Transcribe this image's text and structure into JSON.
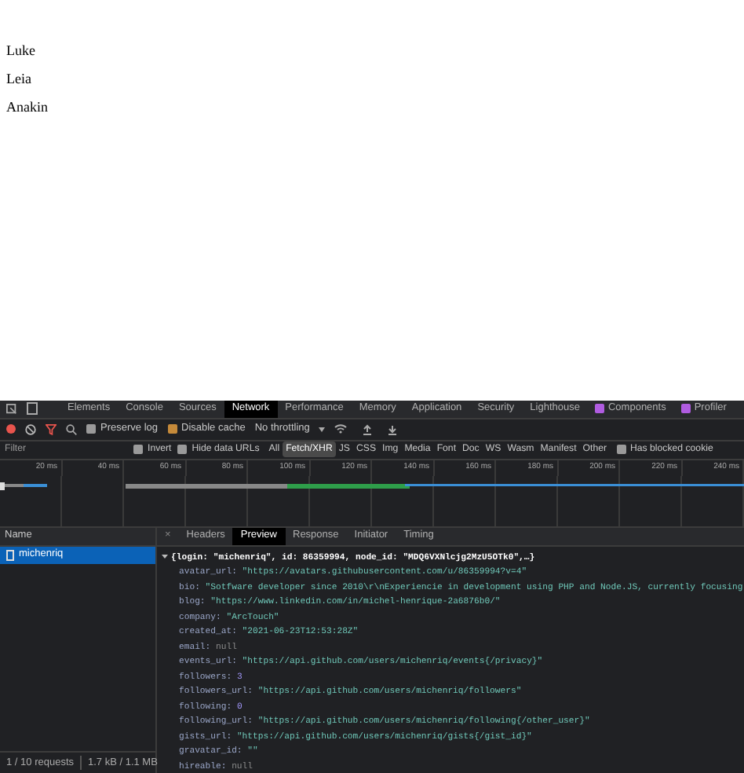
{
  "page": {
    "names": [
      "Luke",
      "Leia",
      "Anakin"
    ]
  },
  "devtools": {
    "panels": [
      {
        "label": "Elements",
        "selected": false,
        "icon": false
      },
      {
        "label": "Console",
        "selected": false,
        "icon": false
      },
      {
        "label": "Sources",
        "selected": false,
        "icon": false
      },
      {
        "label": "Network",
        "selected": true,
        "icon": false
      },
      {
        "label": "Performance",
        "selected": false,
        "icon": false
      },
      {
        "label": "Memory",
        "selected": false,
        "icon": false
      },
      {
        "label": "Application",
        "selected": false,
        "icon": false
      },
      {
        "label": "Security",
        "selected": false,
        "icon": false
      },
      {
        "label": "Lighthouse",
        "selected": false,
        "icon": false
      },
      {
        "label": "Components",
        "selected": false,
        "icon": true
      },
      {
        "label": "Profiler",
        "selected": false,
        "icon": true
      }
    ],
    "toolbar": {
      "preserve_log": {
        "label": "Preserve log",
        "checked": false
      },
      "disable_cache": {
        "label": "Disable cache",
        "checked": true
      },
      "throttling": "No throttling"
    },
    "filter": {
      "placeholder": "Filter",
      "invert": {
        "label": "Invert",
        "checked": false
      },
      "hide_data_urls": {
        "label": "Hide data URLs",
        "checked": false
      },
      "types": [
        {
          "label": "All",
          "selected": false
        },
        {
          "label": "Fetch/XHR",
          "selected": true
        },
        {
          "label": "JS",
          "selected": false
        },
        {
          "label": "CSS",
          "selected": false
        },
        {
          "label": "Img",
          "selected": false
        },
        {
          "label": "Media",
          "selected": false
        },
        {
          "label": "Font",
          "selected": false
        },
        {
          "label": "Doc",
          "selected": false
        },
        {
          "label": "WS",
          "selected": false
        },
        {
          "label": "Wasm",
          "selected": false
        },
        {
          "label": "Manifest",
          "selected": false
        },
        {
          "label": "Other",
          "selected": false
        }
      ],
      "blocked_cookies": {
        "label": "Has blocked cookie",
        "checked": false
      }
    },
    "ruler": [
      "20 ms",
      "40 ms",
      "60 ms",
      "80 ms",
      "100 ms",
      "120 ms",
      "140 ms",
      "160 ms",
      "180 ms",
      "200 ms",
      "220 ms",
      "240 ms"
    ],
    "requests": {
      "column": "Name",
      "rows": [
        {
          "name": "michenriq",
          "selected": true
        }
      ],
      "footer": [
        "1 / 10 requests",
        "1.7 kB / 1.1 MB"
      ]
    },
    "detail": {
      "close": "×",
      "tabs": [
        {
          "label": "Headers",
          "selected": false
        },
        {
          "label": "Preview",
          "selected": true
        },
        {
          "label": "Response",
          "selected": false
        },
        {
          "label": "Initiator",
          "selected": false
        },
        {
          "label": "Timing",
          "selected": false
        }
      ],
      "summary": {
        "text": "{login: \"michenriq\", id: 86359994, node_id: \"MDQ6VXNlcjg2MzU5OTk0\",…}",
        "expanded": true
      },
      "lines": [
        {
          "key": "avatar_url:",
          "value": "\"https://avatars.githubusercontent.com/u/86359994?v=4\"",
          "kind": "string"
        },
        {
          "key": "bio:",
          "value": "\"Sotfware developer since 2010\\r\\nExperiencie in development using PHP and Node.JS, currently focusing",
          "kind": "string"
        },
        {
          "key": "blog:",
          "value": "\"https://www.linkedin.com/in/michel-henrique-2a6876b0/\"",
          "kind": "string"
        },
        {
          "key": "company:",
          "value": "\"ArcTouch\"",
          "kind": "string"
        },
        {
          "key": "created_at:",
          "value": "\"2021-06-23T12:53:28Z\"",
          "kind": "string"
        },
        {
          "key": "email:",
          "value": "null",
          "kind": "null"
        },
        {
          "key": "events_url:",
          "value": "\"https://api.github.com/users/michenriq/events{/privacy}\"",
          "kind": "string"
        },
        {
          "key": "followers:",
          "value": "3",
          "kind": "number"
        },
        {
          "key": "followers_url:",
          "value": "\"https://api.github.com/users/michenriq/followers\"",
          "kind": "string"
        },
        {
          "key": "following:",
          "value": "0",
          "kind": "number"
        },
        {
          "key": "following_url:",
          "value": "\"https://api.github.com/users/michenriq/following{/other_user}\"",
          "kind": "string"
        },
        {
          "key": "gists_url:",
          "value": "\"https://api.github.com/users/michenriq/gists{/gist_id}\"",
          "kind": "string"
        },
        {
          "key": "gravatar_id:",
          "value": "\"\"",
          "kind": "string"
        },
        {
          "key": "hireable:",
          "value": "null",
          "kind": "null"
        }
      ]
    }
  }
}
